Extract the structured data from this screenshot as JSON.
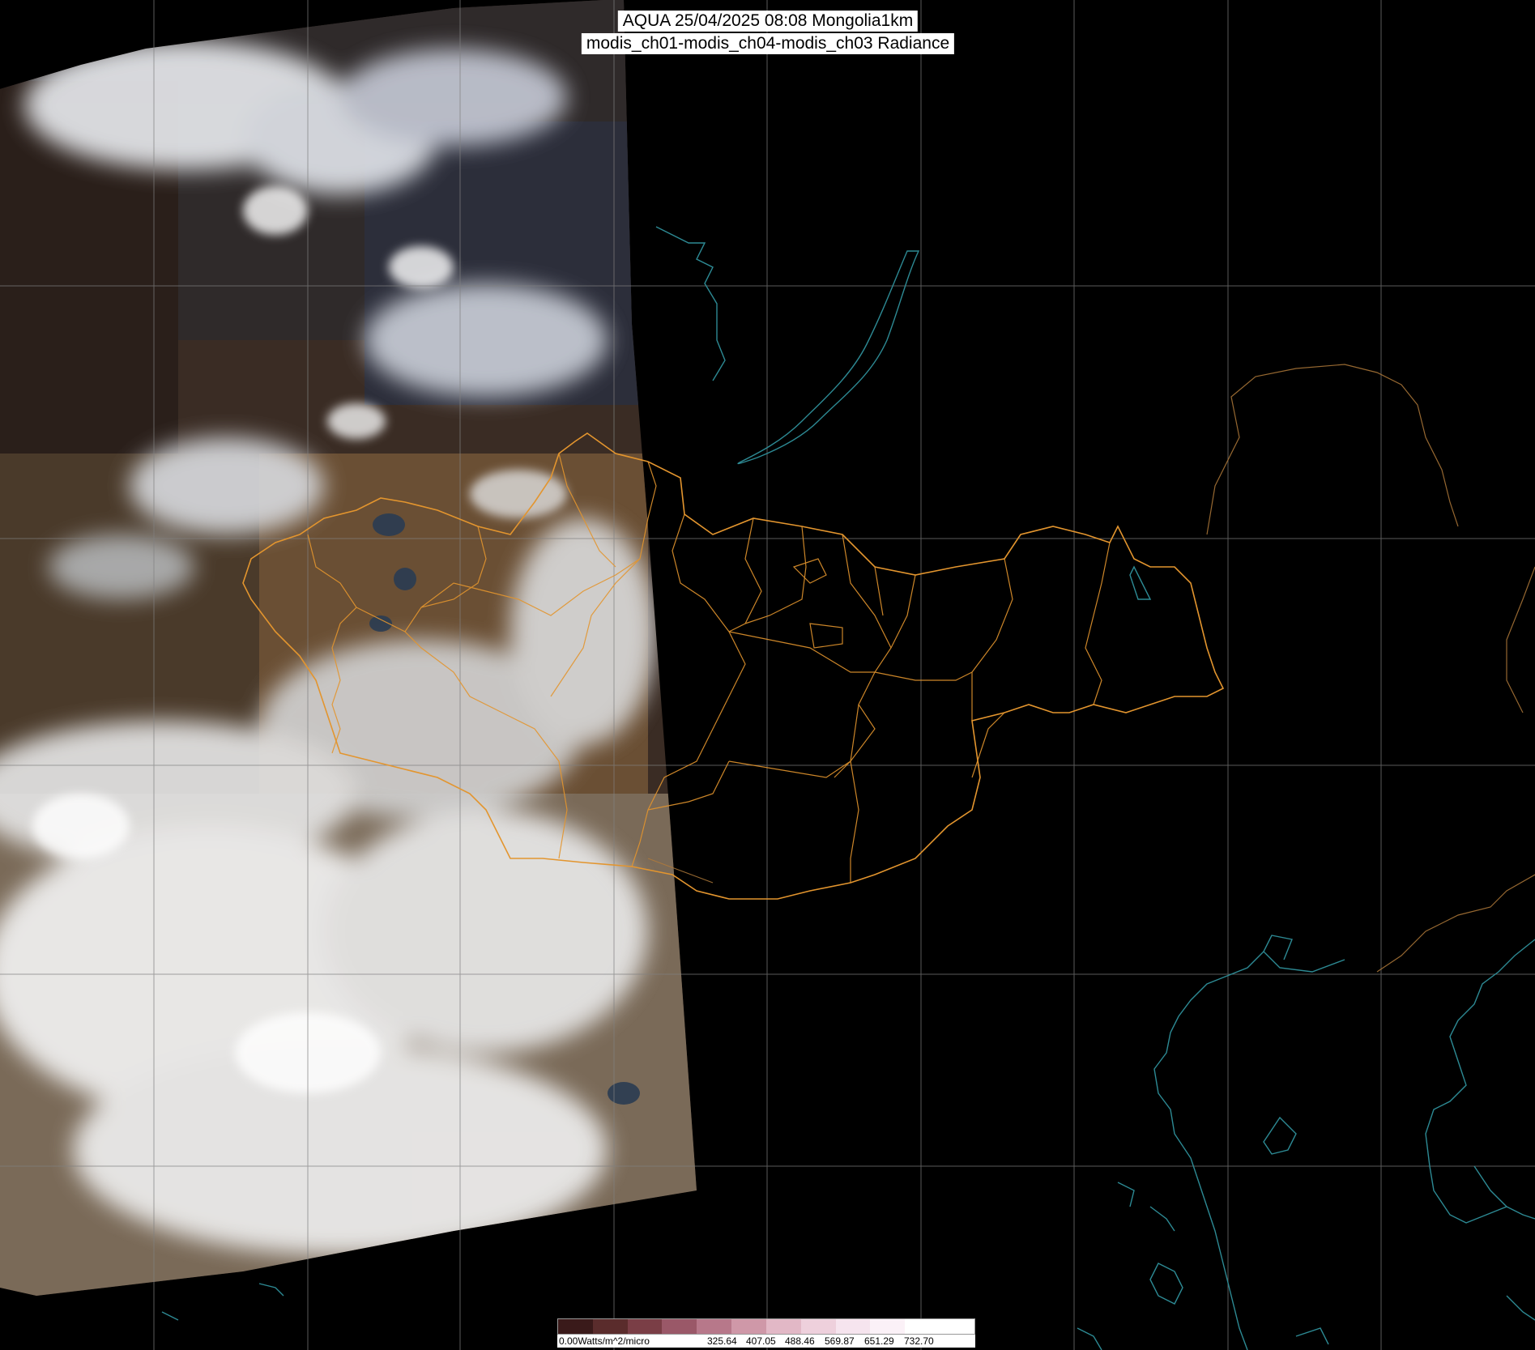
{
  "title": {
    "line1": "AQUA 25/04/2025 08:08 Mongolia1km",
    "line2": "modis_ch01-modis_ch04-modis_ch03 Radiance"
  },
  "legend": {
    "labels": [
      "0.00Watts/m^2/micro",
      "325.64",
      "407.05",
      "488.46",
      "569.87",
      "651.29",
      "732.70"
    ],
    "colors": [
      "#3a1a1a",
      "#5a2c2c",
      "#7a3e46",
      "#9a5868",
      "#b7788a",
      "#cf98a8",
      "#e2b8c6",
      "#eed0dc",
      "#f6e4ee",
      "#fbf1f7",
      "#ffffff",
      "#ffffff"
    ]
  },
  "colors": {
    "border": "#e3952e",
    "coast": "#2d8a94",
    "grid": "#808080",
    "background": "#000000"
  }
}
